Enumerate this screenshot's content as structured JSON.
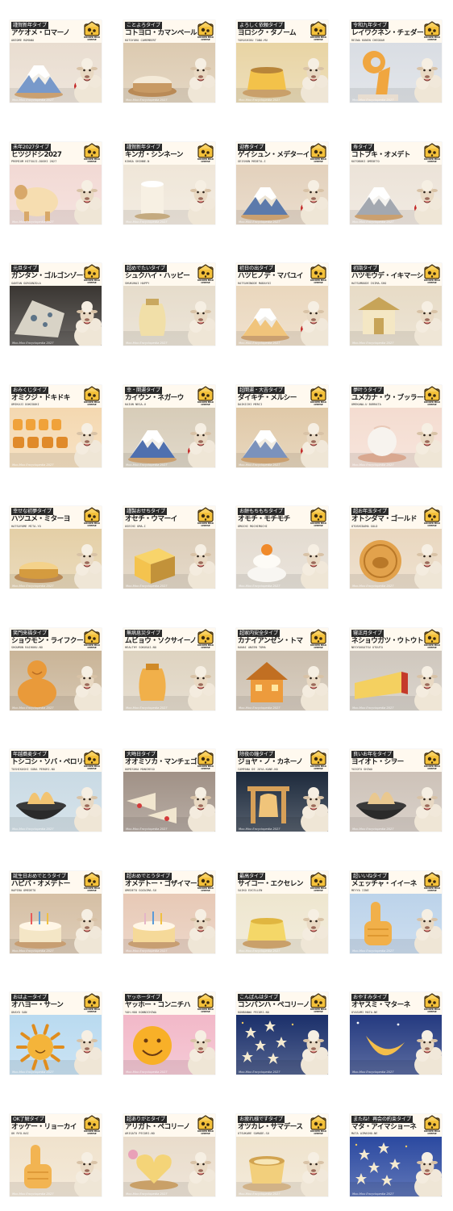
{
  "footer_text": "Moo-Moo Encyclopedia 2027",
  "logo_text": "ROCKER MILK CHEESE",
  "cards": [
    {
      "tag": "謹賀新年タイプ",
      "title": "アケオメ・ロマーノ",
      "roman": "AKEOME ROMANO",
      "scene": "fuji",
      "bg": "#e9ddd0",
      "obj": "#f2efe8",
      "accent": "#6a8fc6"
    },
    {
      "tag": "ことよろタイプ",
      "title": "コトヨロ・カマンベール",
      "roman": "KOTOYORO CAMEMBERT",
      "scene": "wheel",
      "bg": "#dccab0",
      "obj": "#f4ead8",
      "accent": "#c89a64"
    },
    {
      "tag": "よろしく依頼タイプ",
      "title": "ヨロシク・タノーム",
      "roman": "YOROSHIKU TANO-MU",
      "scene": "pudding",
      "bg": "#e8d4a4",
      "obj": "#f3c24a",
      "accent": "#b8853a"
    },
    {
      "tag": "令和九年タイプ",
      "title": "レイワクネン・チェダー",
      "roman": "REIWA KUNEN CHEDDAR",
      "scene": "nine",
      "bg": "#d9dde3",
      "obj": "#f0a640",
      "accent": "#c97b1f"
    },
    {
      "tag": "未年2027タイプ",
      "title": "ヒツジドシ2027",
      "roman": "PREMIUM HITSUJI-DOSHI 2027",
      "scene": "sheepfig",
      "bg": "#f2d9d4",
      "obj": "#f6ddb0",
      "accent": "#d8a86a"
    },
    {
      "tag": "謹賀新年タイプ",
      "title": "キンガ・シンネーン",
      "roman": "KINGA SHINNE-N",
      "scene": "cylinder",
      "bg": "#efe6d8",
      "obj": "#f7f0e3",
      "accent": "#c4aa80"
    },
    {
      "tag": "迎春タイプ",
      "title": "ゲイシュン・メデターイ",
      "roman": "GEISHUN MEDETA-I",
      "scene": "fuji",
      "bg": "#e3d1bc",
      "obj": "#ece4d4",
      "accent": "#4c6ea6"
    },
    {
      "tag": "寿タイプ",
      "title": "コトブキ・オメデト",
      "roman": "KOTOBUKI OMEDETO",
      "scene": "fuji",
      "bg": "#ece3d8",
      "obj": "#f4f2ee",
      "accent": "#9aa0a8"
    },
    {
      "tag": "元旦タイプ",
      "title": "ガンタン・ゴルゴンゾーラ",
      "roman": "GANTAN GORGONZOLA",
      "scene": "blue",
      "bg": "#3a3632",
      "obj": "#d8d3c6",
      "accent": "#5d7488"
    },
    {
      "tag": "超めでたいタイプ",
      "title": "シュクハイ・ハッピー",
      "roman": "SHUKUHAI HAPPY",
      "scene": "vase",
      "bg": "#e6dccb",
      "obj": "#f1dfa8",
      "accent": "#c9a85f"
    },
    {
      "tag": "初日の出タイプ",
      "title": "ハツヒノデ・マバユイ",
      "roman": "HATSUHINODE MABAYUI",
      "scene": "fuji",
      "bg": "#ead7bd",
      "obj": "#eeeae2",
      "accent": "#f0c070"
    },
    {
      "tag": "初詣タイプ",
      "title": "ハツモウデ・イキマーショ",
      "roman": "HATSUMOUDE IKIMA-SHO",
      "scene": "shrine",
      "bg": "#e7dbc6",
      "obj": "#f4e7c4",
      "accent": "#c7a458"
    },
    {
      "tag": "おみくじタイプ",
      "title": "オミクジ・ドキドキ",
      "roman": "OMIKUJI DOKIDOKI",
      "scene": "letters",
      "bg": "#f4d8b0",
      "obj": "#f0a23a",
      "accent": "#e08a2a"
    },
    {
      "tag": "幸・開運タイプ",
      "title": "カイウン・ネガーウ",
      "roman": "KAIUN NEGA-U",
      "scene": "fuji",
      "bg": "#d7ccb8",
      "obj": "#f2efe8",
      "accent": "#3d62a8"
    },
    {
      "tag": "超開運・大吉タイプ",
      "title": "ダイキチ・メルシー",
      "roman": "DAIKICHI MERCI",
      "scene": "fuji",
      "bg": "#e0c9a8",
      "obj": "#f1ece2",
      "accent": "#6e88b8"
    },
    {
      "tag": "夢叶うタイプ",
      "title": "ユメカナ・ウ・ブッラータ",
      "roman": "UMEKANA-U BURRATA",
      "scene": "ball",
      "bg": "#f4dcd0",
      "obj": "#f7f3ee",
      "accent": "#e9c9b8"
    },
    {
      "tag": "幸せな初夢タイプ",
      "title": "ハツユメ・ミターヨ",
      "roman": "HATSUYUME MITA-YO",
      "scene": "wheel",
      "bg": "#e4cfa6",
      "obj": "#f4d28a",
      "accent": "#d49b3f"
    },
    {
      "tag": "謹製おせちタイプ",
      "title": "オセチ・ウマーイ",
      "roman": "OSECHI UMA-I",
      "scene": "block",
      "bg": "#dccdb8",
      "obj": "#f4c34e",
      "accent": "#c2923a"
    },
    {
      "tag": "お餅もちもちタイプ",
      "title": "オモチ・モチモチ",
      "roman": "OMOCHI MOCHIMOCHI",
      "scene": "mochi",
      "bg": "#e3dbd0",
      "obj": "#f8f6f2",
      "accent": "#f08a2a"
    },
    {
      "tag": "超お年玉タイプ",
      "title": "オトシダマ・ゴールド",
      "roman": "OTOSHIDAMA GOLD",
      "scene": "coin",
      "bg": "#e9d7bf",
      "obj": "#e2a24c",
      "accent": "#b97828"
    },
    {
      "tag": "笑門来福タイプ",
      "title": "ショウモン・ライフクーノ",
      "roman": "SHOUMON RAIHUKU-NO",
      "scene": "buddha",
      "bg": "#c9b497",
      "obj": "#e99a3a",
      "accent": "#b86c22"
    },
    {
      "tag": "無病息災タイプ",
      "title": "ムビョウ・ソクサイーノ",
      "roman": "HEALTHY SOKUSAI-NO",
      "scene": "vase",
      "bg": "#ded3c0",
      "obj": "#f1b04a",
      "accent": "#d08a28"
    },
    {
      "tag": "超家内安全タイプ",
      "title": "カナイアンゼン・トマ",
      "roman": "KANAI ANZEN TOMA",
      "scene": "house",
      "bg": "#ccbfae",
      "obj": "#ed9b3c",
      "accent": "#c16f22"
    },
    {
      "tag": "寝正月タイプ",
      "title": "ネショウガツ・ウトウト",
      "roman": "NESYOUGATSU UTOUTO",
      "scene": "wedge",
      "bg": "#cfc7bd",
      "obj": "#f4d060",
      "accent": "#c43a2a"
    },
    {
      "tag": "年越蕎麦タイプ",
      "title": "トシコシ・ソバ・ペロリーノ",
      "roman": "TOSHIKOSHI SOBA PERORI-NO",
      "scene": "bowl",
      "bg": "#c9dae4",
      "obj": "#f2c472",
      "accent": "#7a9fc0"
    },
    {
      "tag": "大晦日タイプ",
      "title": "オオミソカ・マンチェゴ",
      "roman": "OOMISOKA MANCHEGO",
      "scene": "wedges",
      "bg": "#a09186",
      "obj": "#f1e6cf",
      "accent": "#d43a3a"
    },
    {
      "tag": "除夜の鐘タイプ",
      "title": "ジョヤ・ノ・カネーノ",
      "roman": "CAMPANA DE JOYA-KANE-NO",
      "scene": "bell",
      "bg": "#1d2a3c",
      "obj": "#d7a058",
      "accent": "#f0c47a"
    },
    {
      "tag": "良いお年をタイプ",
      "title": "ヨイオト・シヲー",
      "roman": "YOIOTO SHIWO",
      "scene": "bowl",
      "bg": "#cdc2b8",
      "obj": "#e9c890",
      "accent": "#b89068"
    },
    {
      "tag": "誕生日おめでとうタイプ",
      "title": "ハピバ・オメデトー",
      "roman": "HAPIBA OMEDETO",
      "scene": "cake",
      "bg": "#d5bfa4",
      "obj": "#f4e6c6",
      "accent": "#e85a5a"
    },
    {
      "tag": "超おめでとうタイプ",
      "title": "オメデトー・ゴザイマース",
      "roman": "OMEDETO GOZAIMA-SU",
      "scene": "cake",
      "bg": "#e7c9b6",
      "obj": "#f5d999",
      "accent": "#e5b5c8"
    },
    {
      "tag": "最高タイプ",
      "title": "サイコー・エクセレン",
      "roman": "SAIKO EXCELLEN",
      "scene": "pudding",
      "bg": "#eee6cf",
      "obj": "#f4d768",
      "accent": "#e0b640"
    },
    {
      "tag": "超いいねタイプ",
      "title": "メェッチャ・イイーネ",
      "roman": "MEYYA IINE",
      "scene": "thumb",
      "bg": "#bcd3ea",
      "obj": "#f1b04a",
      "accent": "#d38a22"
    },
    {
      "tag": "おはよータイプ",
      "title": "オハヨー・サーン",
      "roman": "OHAYO SAN",
      "scene": "sun",
      "bg": "#b9daf0",
      "obj": "#f4b43a",
      "accent": "#e08d1e"
    },
    {
      "tag": "ヤッホータイプ",
      "title": "ヤッホー・コンニチハ",
      "roman": "YAH-HOO KONNICHIWA",
      "scene": "smile",
      "bg": "#f2b8c8",
      "obj": "#f8b028",
      "accent": "#6a3a12"
    },
    {
      "tag": "こんばんはタイプ",
      "title": "コンバンハ・ペコリーノ",
      "roman": "KONBANWA PECORI-NO",
      "scene": "stars",
      "bg": "#1a2f6a",
      "obj": "#f4ead0",
      "accent": "#f0c860"
    },
    {
      "tag": "おやすみタイプ",
      "title": "オヤスミ・マターネ",
      "roman": "OYASUMI MATA-NE",
      "scene": "moon",
      "bg": "#243a80",
      "obj": "#f4be4a",
      "accent": "#d6a030"
    },
    {
      "tag": "OK了解タイプ",
      "title": "オッケー・リョーカイ",
      "roman": "OK RYO-KAI",
      "scene": "thumb",
      "bg": "#f0e2cc",
      "obj": "#f2b452",
      "accent": "#d48a28"
    },
    {
      "tag": "超ありがとタイプ",
      "title": "アリガト・ペコリーノ",
      "roman": "ARIGATO PECORI-NO",
      "scene": "heart",
      "bg": "#e9dccb",
      "obj": "#f4d478",
      "accent": "#e9a0b8"
    },
    {
      "tag": "お疲れ様ですタイプ",
      "title": "オツカレ・サマデース",
      "roman": "OTSUKARE SAMADE-SU",
      "scene": "cup",
      "bg": "#efe3cd",
      "obj": "#f2cf7c",
      "accent": "#d2a450"
    },
    {
      "tag": "またね！再会の約束タイプ",
      "title": "マタ・アイマショーネ",
      "roman": "MATA AIMASHO-NE",
      "scene": "stars",
      "bg": "#2b49a0",
      "obj": "#f4ead0",
      "accent": "#f0c860"
    }
  ]
}
